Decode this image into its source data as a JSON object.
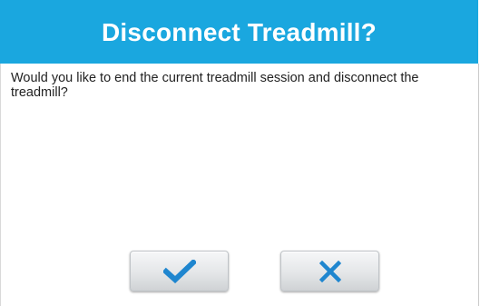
{
  "dialog": {
    "title": "Disconnect Treadmill?",
    "message": "Would you like to end the current treadmill session and disconnect the treadmill?"
  },
  "buttons": {
    "confirm_icon": "checkmark-icon",
    "cancel_icon": "close-icon"
  },
  "colors": {
    "header": "#1aa7df",
    "title_text": "#ffffff",
    "icon": "#1f86cf"
  }
}
